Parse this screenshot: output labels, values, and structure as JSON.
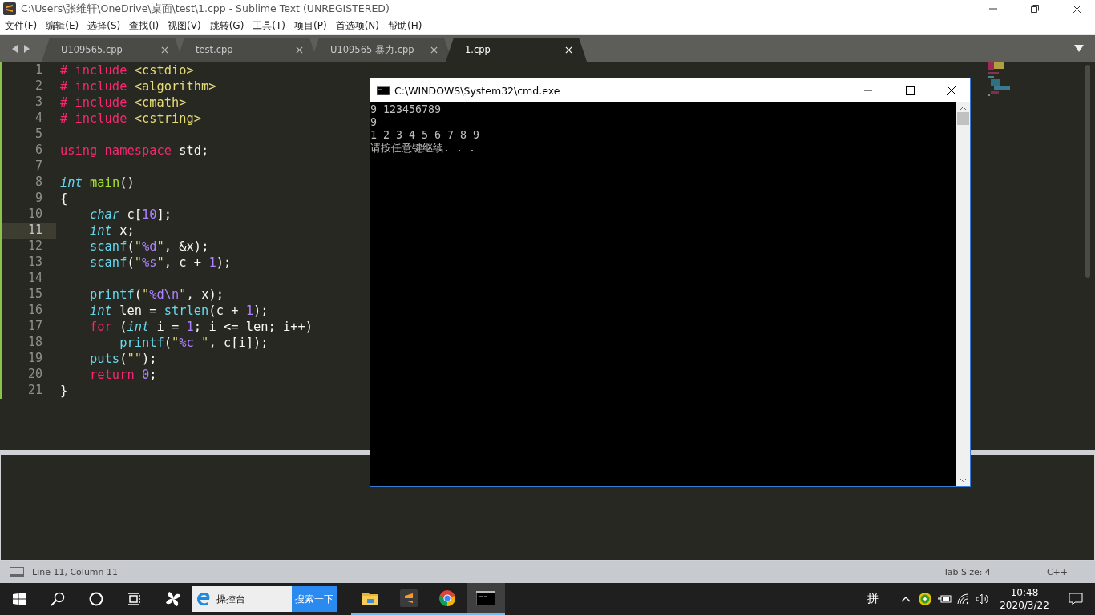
{
  "window": {
    "title": "C:\\Users\\张维轩\\OneDrive\\桌面\\test\\1.cpp - Sublime Text (UNREGISTERED)"
  },
  "menu": [
    "文件(F)",
    "编辑(E)",
    "选择(S)",
    "查找(I)",
    "视图(V)",
    "跳转(G)",
    "工具(T)",
    "项目(P)",
    "首选项(N)",
    "帮助(H)"
  ],
  "tabs": [
    {
      "label": "U109565.cpp",
      "selected": false
    },
    {
      "label": "test.cpp",
      "selected": false
    },
    {
      "label": "U109565 暴力.cpp",
      "selected": false
    },
    {
      "label": "1.cpp",
      "selected": true
    }
  ],
  "editor": {
    "lines": [
      {
        "number": "1",
        "current": false,
        "tokens": [
          {
            "text": "# include ",
            "kind": "keyword"
          },
          {
            "text": "<cstdio>",
            "kind": "string"
          }
        ]
      },
      {
        "number": "2",
        "current": false,
        "tokens": [
          {
            "text": "# include ",
            "kind": "keyword"
          },
          {
            "text": "<algorithm>",
            "kind": "string"
          }
        ]
      },
      {
        "number": "3",
        "current": false,
        "tokens": [
          {
            "text": "# include ",
            "kind": "keyword"
          },
          {
            "text": "<cmath>",
            "kind": "string"
          }
        ]
      },
      {
        "number": "4",
        "current": false,
        "tokens": [
          {
            "text": "# include ",
            "kind": "keyword"
          },
          {
            "text": "<cstring>",
            "kind": "string"
          }
        ]
      },
      {
        "number": "5",
        "current": false
      },
      {
        "number": "6",
        "current": false,
        "tokens": [
          {
            "text": "using namespace",
            "kind": "keyword"
          },
          {
            "text": " std;",
            "kind": "plain"
          }
        ]
      },
      {
        "number": "7",
        "current": false
      },
      {
        "number": "8",
        "current": false,
        "tokens": [
          {
            "text": "int",
            "kind": "type"
          },
          {
            "text": " main",
            "kind": "entity"
          },
          {
            "text": "()",
            "kind": "plain"
          }
        ]
      },
      {
        "number": "9",
        "current": false,
        "tokens": [
          {
            "text": "{",
            "kind": "plain"
          }
        ]
      },
      {
        "number": "10",
        "current": false,
        "tokens": [
          {
            "text": "    char",
            "kind": "type"
          },
          {
            "text": " c[",
            "kind": "plain"
          },
          {
            "text": "10",
            "kind": "number"
          },
          {
            "text": "];",
            "kind": "plain"
          }
        ]
      },
      {
        "number": "11",
        "current": true,
        "tokens": [
          {
            "text": "    int",
            "kind": "type"
          },
          {
            "text": " x;",
            "kind": "plain"
          }
        ]
      },
      {
        "number": "12",
        "current": false,
        "tokens": [
          {
            "text": "    scanf",
            "kind": "function"
          },
          {
            "text": "(",
            "kind": "plain"
          },
          {
            "text": "\"",
            "kind": "string"
          },
          {
            "text": "%d",
            "kind": "number"
          },
          {
            "text": "\"",
            "kind": "string"
          },
          {
            "text": ", &x);",
            "kind": "plain"
          }
        ]
      },
      {
        "number": "13",
        "current": false,
        "tokens": [
          {
            "text": "    scanf",
            "kind": "function"
          },
          {
            "text": "(",
            "kind": "plain"
          },
          {
            "text": "\"",
            "kind": "string"
          },
          {
            "text": "%s",
            "kind": "number"
          },
          {
            "text": "\"",
            "kind": "string"
          },
          {
            "text": ", c + ",
            "kind": "plain"
          },
          {
            "text": "1",
            "kind": "number"
          },
          {
            "text": ");",
            "kind": "plain"
          }
        ]
      },
      {
        "number": "14",
        "current": false
      },
      {
        "number": "15",
        "current": false,
        "tokens": [
          {
            "text": "    printf",
            "kind": "function"
          },
          {
            "text": "(",
            "kind": "plain"
          },
          {
            "text": "\"",
            "kind": "string"
          },
          {
            "text": "%d\\n",
            "kind": "number"
          },
          {
            "text": "\"",
            "kind": "string"
          },
          {
            "text": ", x);",
            "kind": "plain"
          }
        ]
      },
      {
        "number": "16",
        "current": false,
        "tokens": [
          {
            "text": "    int",
            "kind": "type"
          },
          {
            "text": " len = ",
            "kind": "plain"
          },
          {
            "text": "strlen",
            "kind": "function"
          },
          {
            "text": "(c + ",
            "kind": "plain"
          },
          {
            "text": "1",
            "kind": "number"
          },
          {
            "text": ");",
            "kind": "plain"
          }
        ]
      },
      {
        "number": "17",
        "current": false,
        "tokens": [
          {
            "text": "    for",
            "kind": "keyword"
          },
          {
            "text": " (",
            "kind": "plain"
          },
          {
            "text": "int",
            "kind": "type"
          },
          {
            "text": " i = ",
            "kind": "plain"
          },
          {
            "text": "1",
            "kind": "number"
          },
          {
            "text": "; i <= len; i++)",
            "kind": "plain"
          }
        ]
      },
      {
        "number": "18",
        "current": false,
        "tokens": [
          {
            "text": "        printf",
            "kind": "function"
          },
          {
            "text": "(",
            "kind": "plain"
          },
          {
            "text": "\"",
            "kind": "string"
          },
          {
            "text": "%c",
            "kind": "number"
          },
          {
            "text": " \"",
            "kind": "string"
          },
          {
            "text": ", c[i]);",
            "kind": "plain"
          }
        ]
      },
      {
        "number": "19",
        "current": false,
        "tokens": [
          {
            "text": "    puts",
            "kind": "function"
          },
          {
            "text": "(",
            "kind": "plain"
          },
          {
            "text": "\"\"",
            "kind": "string"
          },
          {
            "text": ");",
            "kind": "plain"
          }
        ]
      },
      {
        "number": "20",
        "current": false,
        "tokens": [
          {
            "text": "    return",
            "kind": "keyword"
          },
          {
            "text": " 0",
            "kind": "number"
          },
          {
            "text": ";",
            "kind": "plain"
          }
        ]
      },
      {
        "number": "21",
        "current": false,
        "tokens": [
          {
            "text": "}",
            "kind": "plain"
          }
        ]
      }
    ]
  },
  "console_window": {
    "title": "C:\\WINDOWS\\System32\\cmd.exe",
    "output": [
      "9 123456789",
      "9",
      "1 2 3 4 5 6 7 8 9",
      "请按任意键继续. . ."
    ]
  },
  "status_bar": {
    "position": "Line 11, Column 11",
    "tab_size": "Tab Size: 4",
    "syntax": "C++"
  },
  "taskbar": {
    "search_text": "操控台",
    "search_button": "搜索一下",
    "apps": [
      {
        "kind": "folder",
        "running": true,
        "active": false
      },
      {
        "kind": "sublime",
        "running": true,
        "active": false
      },
      {
        "kind": "chrome",
        "running": true,
        "active": false
      },
      {
        "kind": "console",
        "running": true,
        "active": true
      }
    ],
    "ime": "拼",
    "time": "10:48",
    "date": "2020/3/22"
  }
}
